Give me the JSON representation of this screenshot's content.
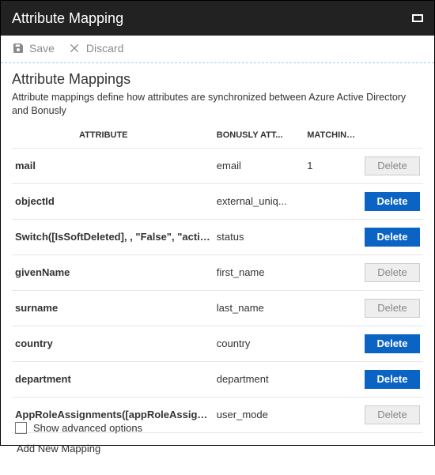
{
  "titlebar": {
    "title": "Attribute Mapping"
  },
  "toolbar": {
    "save_label": "Save",
    "discard_label": "Discard"
  },
  "section": {
    "heading": "Attribute Mappings",
    "description": "Attribute mappings define how attributes are synchronized between Azure Active Directory and Bonusly"
  },
  "table": {
    "headers": {
      "attribute": "ATTRIBUTE",
      "bonusly": "BONUSLY ATT...",
      "matching": "MATCHING ..."
    },
    "rows": [
      {
        "attribute": "mail",
        "bonusly": "email",
        "matching": "1",
        "delete_active": false
      },
      {
        "attribute": "objectId",
        "bonusly": "external_uniq...",
        "matching": "",
        "delete_active": true
      },
      {
        "attribute": "Switch([IsSoftDeleted], , \"False\", \"active\", \"True",
        "bonusly": "status",
        "matching": "",
        "delete_active": true
      },
      {
        "attribute": "givenName",
        "bonusly": "first_name",
        "matching": "",
        "delete_active": false
      },
      {
        "attribute": "surname",
        "bonusly": "last_name",
        "matching": "",
        "delete_active": false
      },
      {
        "attribute": "country",
        "bonusly": "country",
        "matching": "",
        "delete_active": true
      },
      {
        "attribute": "department",
        "bonusly": "department",
        "matching": "",
        "delete_active": true
      },
      {
        "attribute": "AppRoleAssignments([appRoleAssignments])",
        "bonusly": "user_mode",
        "matching": "",
        "delete_active": false
      }
    ],
    "delete_label": "Delete",
    "add_new": "Add New Mapping"
  },
  "footer": {
    "advanced": "Show advanced options"
  }
}
